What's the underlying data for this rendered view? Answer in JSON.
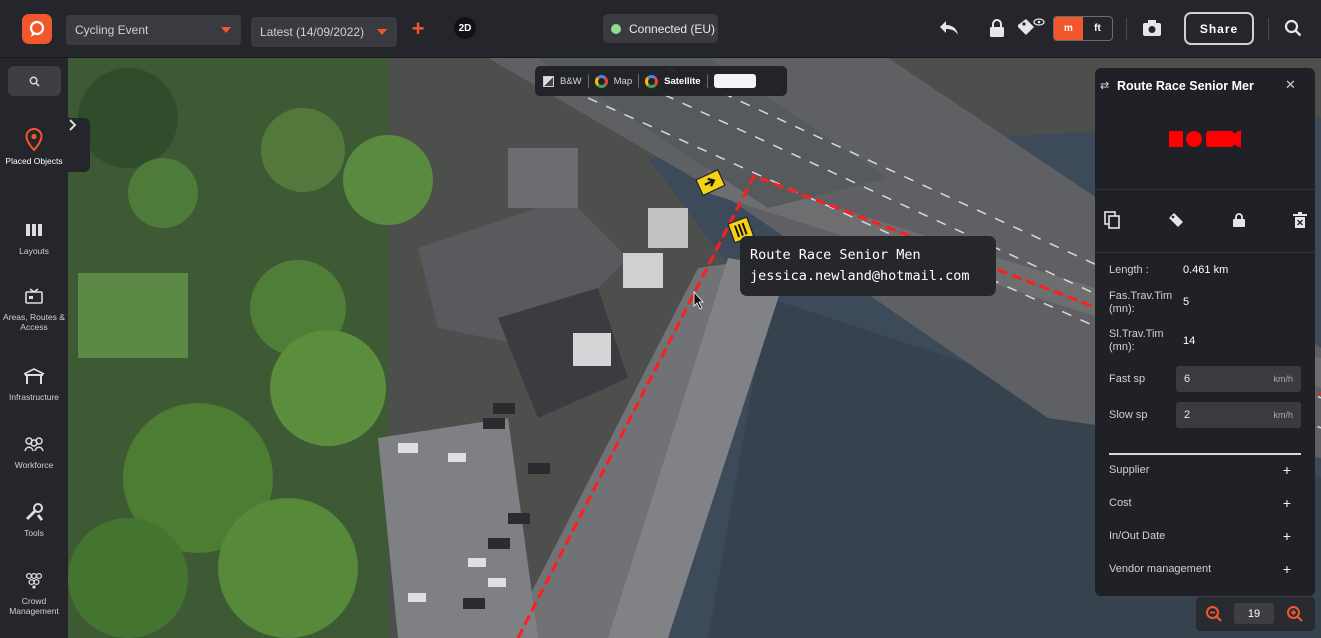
{
  "header": {
    "event_select": "Cycling Event",
    "version_select": "Latest (14/09/2022)",
    "view_mode": "2D",
    "connection": "Connected (EU)",
    "units": [
      "m",
      "ft"
    ],
    "active_unit": "m",
    "share_label": "Share",
    "accent_color": "#f0582b"
  },
  "sidebar": {
    "items": [
      {
        "label": "Placed Objects",
        "icon": "pin-icon",
        "active": true
      },
      {
        "label": "Layouts",
        "icon": "layouts-icon"
      },
      {
        "label": "Areas, Routes & Access",
        "icon": "areas-icon"
      },
      {
        "label": "Infrastructure",
        "icon": "infrastructure-icon"
      },
      {
        "label": "Workforce",
        "icon": "workforce-icon"
      },
      {
        "label": "Tools",
        "icon": "tools-icon"
      },
      {
        "label": "Crowd Management",
        "icon": "crowd-icon"
      }
    ]
  },
  "map": {
    "layers": {
      "bw": "B&W",
      "map": "Map",
      "satellite": "Satellite"
    },
    "tooltip": {
      "title": "Route Race Senior Men",
      "email": "jessica.newland@hotmail.com"
    },
    "zoom_level": "19"
  },
  "panel": {
    "title": "Route Race Senior Mer",
    "route_color": "#ff0000",
    "fields": [
      {
        "label": "Length :",
        "value": "0.461 km"
      },
      {
        "label": "Fas.Trav.Tim (mn):",
        "value": "5"
      },
      {
        "label": "Sl.Trav.Tim (mn):",
        "value": "14"
      }
    ],
    "fast_sp": {
      "label": "Fast sp",
      "value": "6",
      "unit": "km/h"
    },
    "slow_sp": {
      "label": "Slow sp",
      "value": "2",
      "unit": "km/h"
    },
    "expandables": [
      "Supplier",
      "Cost",
      "In/Out Date",
      "Vendor management"
    ]
  }
}
